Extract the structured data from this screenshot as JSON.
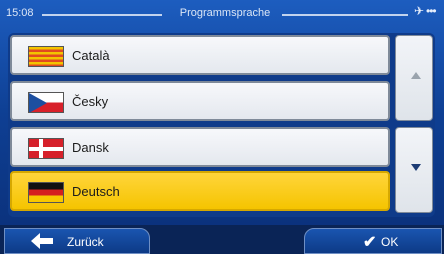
{
  "statusbar": {
    "time": "15:08",
    "title": "Programmsprache",
    "gps_icon": "satellite-icon",
    "signal_dots": "•••"
  },
  "languages": [
    {
      "label": "Català",
      "flag": "flag-catalonia-icon",
      "selected": false
    },
    {
      "label": "Česky",
      "flag": "flag-czech-icon",
      "selected": false
    },
    {
      "label": "Dansk",
      "flag": "flag-denmark-icon",
      "selected": false
    },
    {
      "label": "Deutsch",
      "flag": "flag-germany-icon",
      "selected": true
    }
  ],
  "scroll": {
    "up_icon": "chevron-up-icon",
    "down_icon": "chevron-down-icon"
  },
  "footer": {
    "back_label": "Zurück",
    "ok_label": "OK"
  },
  "colors": {
    "selected_row": "#f5c400",
    "background": "#0e3f93"
  }
}
